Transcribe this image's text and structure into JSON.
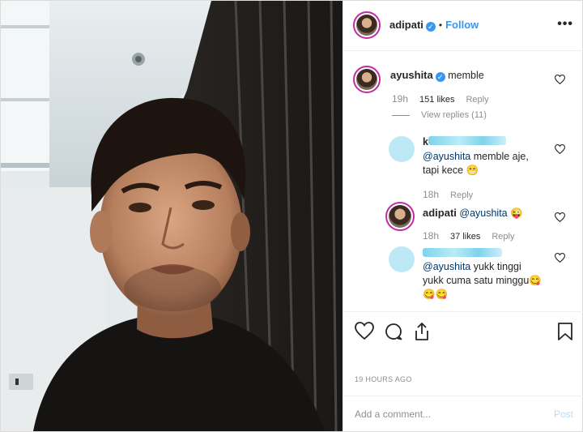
{
  "post": {
    "author": "adipati",
    "follow_label": "Follow",
    "separator": "•",
    "more_icon": "more-horizontal-icon"
  },
  "comments": [
    {
      "user": "ayushita",
      "verified": true,
      "text": "memble",
      "time": "19h",
      "likes": "151 likes",
      "reply": "Reply",
      "view_replies": "View replies (11)"
    },
    {
      "user_hidden": true,
      "user_partial": "k",
      "mention": "@ayushita",
      "text_line1": " memble aje,",
      "text_line2": "tapi kece 😁",
      "time": "18h",
      "reply": "Reply"
    },
    {
      "user": "adipati",
      "mention": "@ayushita",
      "emoji": " 😜",
      "time": "18h",
      "likes": "37 likes",
      "reply": "Reply"
    },
    {
      "user_hidden": true,
      "mention": "@ayushita",
      "text_line1": " yukk tinggi",
      "text_line2": "yukk cuma satu minggu😋",
      "text_line3": "😋😋"
    }
  ],
  "actions": {
    "like_icon": "heart-icon",
    "comment_icon": "comment-icon",
    "share_icon": "share-icon",
    "save_icon": "bookmark-icon"
  },
  "timestamp": "19 HOURS AGO",
  "add_comment": {
    "placeholder": "Add a comment...",
    "post_label": "Post"
  },
  "colors": {
    "accent": "#3897f0",
    "story_ring": "#c32aa3",
    "muted": "#8e8e8e",
    "border": "#efefef"
  }
}
